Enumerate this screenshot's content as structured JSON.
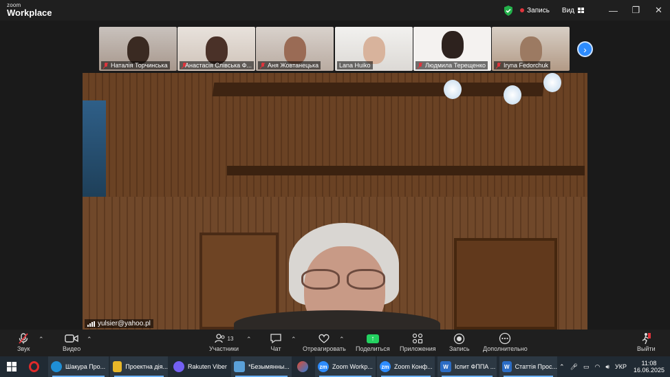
{
  "app": {
    "logo_line1": "zoom",
    "logo_line2": "Workplace"
  },
  "titlebar": {
    "recording_label": "Запись",
    "view_label": "Вид",
    "minimize": "—",
    "restore": "❐",
    "close": "✕"
  },
  "participants": [
    {
      "name": "Наталія Торчинська",
      "muted": true
    },
    {
      "name": "Анастасія Слівська Ф...",
      "muted": true
    },
    {
      "name": "Аня Жовтанецька",
      "muted": true
    },
    {
      "name": "Lana Huiko",
      "muted": false
    },
    {
      "name": "Людмила Терещенко",
      "muted": true
    },
    {
      "name": "Iryna Fedorchuk",
      "muted": true
    }
  ],
  "thumb_colors": [
    "#8a6a55",
    "#7b4e40",
    "#b7a69a",
    "#e6e3df",
    "#f2f0ee",
    "#b88a66"
  ],
  "next_button": "›",
  "main_speaker": {
    "name": "yulsier@yahoo.pl"
  },
  "toolbar": {
    "audio": "Звук",
    "video": "Видео",
    "participants": "Участники",
    "participants_count": "13",
    "chat": "Чат",
    "react": "Отреагировать",
    "share": "Поделиться",
    "apps": "Приложения",
    "record": "Запись",
    "more": "Дополнительно",
    "leave": "Выйти"
  },
  "taskbar": {
    "items": [
      {
        "label": "Шакура Про...",
        "icon": "edge-icon",
        "color": "#1f8fd6"
      },
      {
        "label": "Проектна дія...",
        "icon": "folder-icon",
        "color": "#e8b729"
      },
      {
        "label": "Rakuten Viber",
        "icon": "viber-icon",
        "color": "#7360f2"
      },
      {
        "label": "*Безымянны...",
        "icon": "notepad-icon",
        "color": "#5aa0d8"
      },
      {
        "label": "Zoom Workp...",
        "icon": "zoom-icon",
        "color": "#2d8cff"
      },
      {
        "label": "Zoom Конф...",
        "icon": "zoom-icon",
        "color": "#2d8cff"
      },
      {
        "label": "Іспит ФППА ...",
        "icon": "word-icon",
        "color": "#2b6cc4"
      },
      {
        "label": "Статтія Прос...",
        "icon": "word-icon",
        "color": "#2b6cc4"
      }
    ],
    "lang": "УКР",
    "time": "11:08",
    "date": "16.06.2025"
  }
}
